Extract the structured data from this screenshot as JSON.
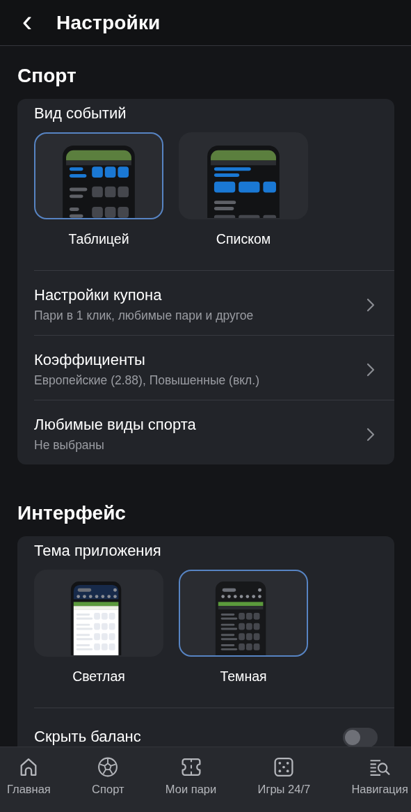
{
  "header": {
    "back_icon": "‹",
    "title": "Настройки"
  },
  "sections": [
    {
      "title": "Спорт",
      "card": {
        "choice_title": "Вид событий",
        "options": [
          {
            "label": "Таблицей",
            "kind": "table",
            "selected": true
          },
          {
            "label": "Списком",
            "kind": "list",
            "selected": false
          }
        ],
        "rows": [
          {
            "kind": "link",
            "title": "Настройки купона",
            "subtitle": "Пари в 1 клик, любимые пари и другое"
          },
          {
            "kind": "link",
            "title": "Коэффициенты",
            "subtitle": "Европейские (2.88), Повышенные (вкл.)"
          },
          {
            "kind": "link",
            "title": "Любимые виды спорта",
            "subtitle": "Не выбраны"
          }
        ]
      }
    },
    {
      "title": "Интерфейс",
      "card": {
        "choice_title": "Тема приложения",
        "options": [
          {
            "label": "Светлая",
            "kind": "light",
            "selected": false
          },
          {
            "label": "Темная",
            "kind": "dark",
            "selected": true
          }
        ],
        "rows": [
          {
            "kind": "toggle",
            "title": "Скрыть баланс",
            "on": false
          }
        ]
      }
    }
  ],
  "tab_bar": [
    {
      "label": "Главная",
      "kind": "home"
    },
    {
      "label": "Спорт",
      "kind": "ball"
    },
    {
      "label": "Мои пари",
      "kind": "ticket"
    },
    {
      "label": "Игры 24/7",
      "kind": "dice"
    },
    {
      "label": "Навигация",
      "kind": "nav"
    }
  ]
}
